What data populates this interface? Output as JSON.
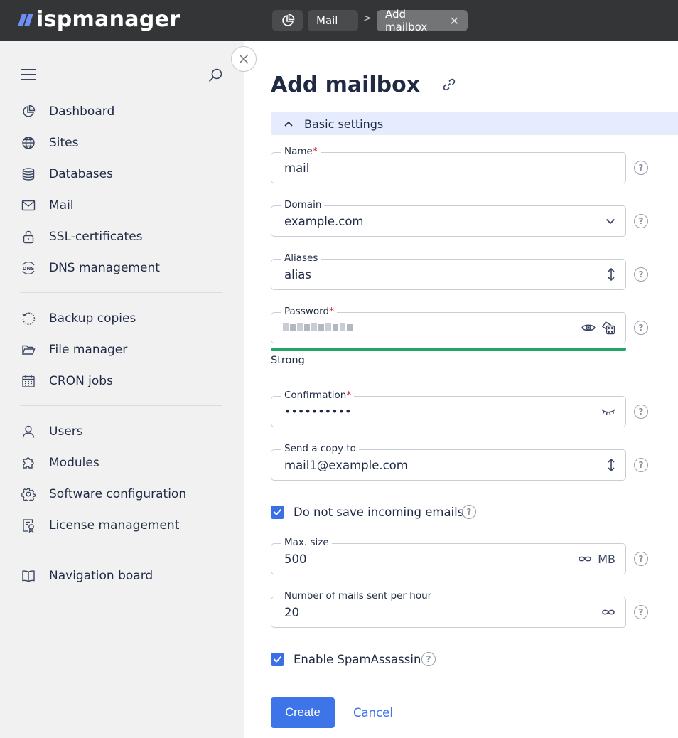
{
  "app": {
    "logo_text": "ispmanager",
    "brand_color": "#6f8ff5"
  },
  "breadcrumbs": {
    "home_icon": "pie-chart-icon",
    "mail": "Mail",
    "separator": ">",
    "active": "Add mailbox"
  },
  "sidebar": {
    "groups": [
      [
        {
          "label": "Dashboard",
          "icon": "dashboard-icon"
        },
        {
          "label": "Sites",
          "icon": "globe-icon"
        },
        {
          "label": "Databases",
          "icon": "database-icon"
        },
        {
          "label": "Mail",
          "icon": "mail-icon"
        },
        {
          "label": "SSL-certificates",
          "icon": "lock-icon"
        },
        {
          "label": "DNS management",
          "icon": "dns-icon"
        }
      ],
      [
        {
          "label": "Backup copies",
          "icon": "backup-icon"
        },
        {
          "label": "File manager",
          "icon": "folder-icon"
        },
        {
          "label": "CRON jobs",
          "icon": "calendar-icon"
        }
      ],
      [
        {
          "label": "Users",
          "icon": "user-icon"
        },
        {
          "label": "Modules",
          "icon": "puzzle-icon"
        },
        {
          "label": "Software configuration",
          "icon": "gear-icon"
        },
        {
          "label": "License management",
          "icon": "license-icon"
        }
      ],
      [
        {
          "label": "Navigation board",
          "icon": "book-icon"
        }
      ]
    ]
  },
  "main": {
    "title": "Add mailbox",
    "section": "Basic settings",
    "fields": {
      "name": {
        "label": "Name",
        "required": "*",
        "value": "mail"
      },
      "domain": {
        "label": "Domain",
        "value": "example.com"
      },
      "aliases": {
        "label": "Aliases",
        "value": "alias"
      },
      "password": {
        "label": "Password",
        "required": "*",
        "strength": "Strong",
        "strength_color": "#21a663"
      },
      "confirmation": {
        "label": "Confirmation",
        "required": "*",
        "value": "••••••••••"
      },
      "send_copy": {
        "label": "Send a copy to",
        "value": "mail1@example.com"
      },
      "max_size": {
        "label": "Max. size",
        "value": "500",
        "unit": "MB"
      },
      "mails_per_hour": {
        "label": "Number of mails sent per hour",
        "value": "20"
      }
    },
    "checkboxes": {
      "no_save": {
        "label": "Do not save incoming emails",
        "checked": true
      },
      "spamassassin": {
        "label": "Enable SpamAssassin",
        "checked": true
      }
    },
    "buttons": {
      "create": "Create",
      "cancel": "Cancel"
    },
    "help_glyph": "?"
  }
}
